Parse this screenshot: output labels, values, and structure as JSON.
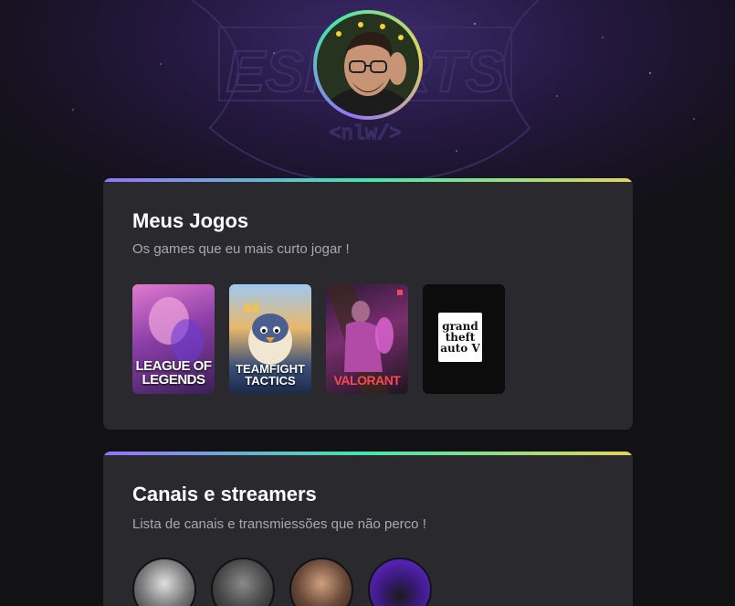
{
  "profile": {
    "avatar_icon": "profile-photo"
  },
  "background": {
    "watermark": "ESPORTS",
    "watermark_sub": "<nlw/>"
  },
  "games_card": {
    "title": "Meus Jogos",
    "subtitle": "Os games que eu mais curto jogar !",
    "games": [
      {
        "title": "LEAGUE OF\nLEGENDS"
      },
      {
        "title": "TEAMFIGHT\nTACTICS"
      },
      {
        "title": "VALORANT"
      },
      {
        "title": "grand\ntheft\nauto V"
      }
    ]
  },
  "streamers_card": {
    "title": "Canais e streamers",
    "subtitle": "Lista de canais e transmiessões que não perco !"
  },
  "colors": {
    "gradient": [
      "#9572fc",
      "#43e7ad",
      "#e2d45c"
    ],
    "card_bg": "#29292e",
    "page_bg": "#121214"
  }
}
